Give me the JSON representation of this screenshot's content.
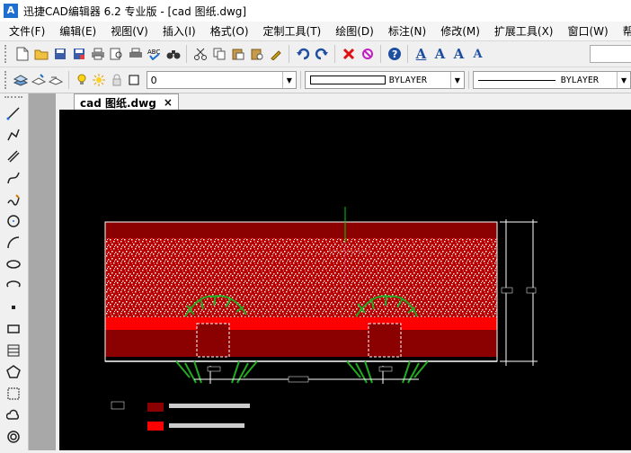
{
  "window": {
    "title": "迅捷CAD编辑器 6.2 专业版  - [cad 图纸.dwg]",
    "logo": "A"
  },
  "menu": [
    "文件(F)",
    "编辑(E)",
    "视图(V)",
    "插入(I)",
    "格式(O)",
    "定制工具(T)",
    "绘图(D)",
    "标注(N)",
    "修改(M)",
    "扩展工具(X)",
    "窗口(W)",
    "帮助(H)"
  ],
  "toolbar2": {
    "layer_value": "0",
    "linetype_value": "BYLAYER",
    "lineweight_value": "BYLAYER"
  },
  "tabs": [
    {
      "label": "cad 图纸.dwg",
      "close": "×"
    }
  ],
  "colors": {
    "canvas": "#000000",
    "hatch_dark": "#8b0000",
    "hatch_red": "#ff0000",
    "plant_green": "#22aa22",
    "axis_green": "#00cc00"
  }
}
